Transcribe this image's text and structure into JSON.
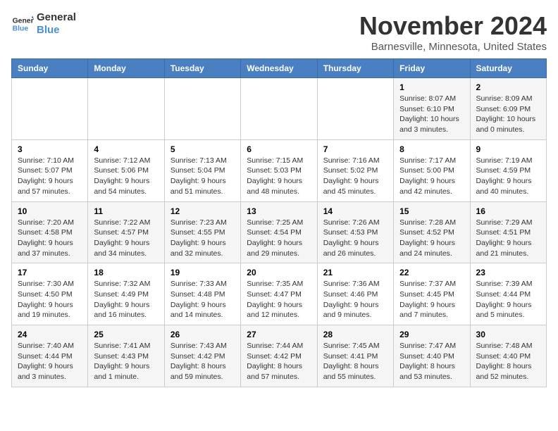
{
  "logo": {
    "text_general": "General",
    "text_blue": "Blue"
  },
  "header": {
    "title": "November 2024",
    "subtitle": "Barnesville, Minnesota, United States"
  },
  "weekdays": [
    "Sunday",
    "Monday",
    "Tuesday",
    "Wednesday",
    "Thursday",
    "Friday",
    "Saturday"
  ],
  "weeks": [
    [
      {
        "day": "",
        "info": ""
      },
      {
        "day": "",
        "info": ""
      },
      {
        "day": "",
        "info": ""
      },
      {
        "day": "",
        "info": ""
      },
      {
        "day": "",
        "info": ""
      },
      {
        "day": "1",
        "info": "Sunrise: 8:07 AM\nSunset: 6:10 PM\nDaylight: 10 hours and 3 minutes."
      },
      {
        "day": "2",
        "info": "Sunrise: 8:09 AM\nSunset: 6:09 PM\nDaylight: 10 hours and 0 minutes."
      }
    ],
    [
      {
        "day": "3",
        "info": "Sunrise: 7:10 AM\nSunset: 5:07 PM\nDaylight: 9 hours and 57 minutes."
      },
      {
        "day": "4",
        "info": "Sunrise: 7:12 AM\nSunset: 5:06 PM\nDaylight: 9 hours and 54 minutes."
      },
      {
        "day": "5",
        "info": "Sunrise: 7:13 AM\nSunset: 5:04 PM\nDaylight: 9 hours and 51 minutes."
      },
      {
        "day": "6",
        "info": "Sunrise: 7:15 AM\nSunset: 5:03 PM\nDaylight: 9 hours and 48 minutes."
      },
      {
        "day": "7",
        "info": "Sunrise: 7:16 AM\nSunset: 5:02 PM\nDaylight: 9 hours and 45 minutes."
      },
      {
        "day": "8",
        "info": "Sunrise: 7:17 AM\nSunset: 5:00 PM\nDaylight: 9 hours and 42 minutes."
      },
      {
        "day": "9",
        "info": "Sunrise: 7:19 AM\nSunset: 4:59 PM\nDaylight: 9 hours and 40 minutes."
      }
    ],
    [
      {
        "day": "10",
        "info": "Sunrise: 7:20 AM\nSunset: 4:58 PM\nDaylight: 9 hours and 37 minutes."
      },
      {
        "day": "11",
        "info": "Sunrise: 7:22 AM\nSunset: 4:57 PM\nDaylight: 9 hours and 34 minutes."
      },
      {
        "day": "12",
        "info": "Sunrise: 7:23 AM\nSunset: 4:55 PM\nDaylight: 9 hours and 32 minutes."
      },
      {
        "day": "13",
        "info": "Sunrise: 7:25 AM\nSunset: 4:54 PM\nDaylight: 9 hours and 29 minutes."
      },
      {
        "day": "14",
        "info": "Sunrise: 7:26 AM\nSunset: 4:53 PM\nDaylight: 9 hours and 26 minutes."
      },
      {
        "day": "15",
        "info": "Sunrise: 7:28 AM\nSunset: 4:52 PM\nDaylight: 9 hours and 24 minutes."
      },
      {
        "day": "16",
        "info": "Sunrise: 7:29 AM\nSunset: 4:51 PM\nDaylight: 9 hours and 21 minutes."
      }
    ],
    [
      {
        "day": "17",
        "info": "Sunrise: 7:30 AM\nSunset: 4:50 PM\nDaylight: 9 hours and 19 minutes."
      },
      {
        "day": "18",
        "info": "Sunrise: 7:32 AM\nSunset: 4:49 PM\nDaylight: 9 hours and 16 minutes."
      },
      {
        "day": "19",
        "info": "Sunrise: 7:33 AM\nSunset: 4:48 PM\nDaylight: 9 hours and 14 minutes."
      },
      {
        "day": "20",
        "info": "Sunrise: 7:35 AM\nSunset: 4:47 PM\nDaylight: 9 hours and 12 minutes."
      },
      {
        "day": "21",
        "info": "Sunrise: 7:36 AM\nSunset: 4:46 PM\nDaylight: 9 hours and 9 minutes."
      },
      {
        "day": "22",
        "info": "Sunrise: 7:37 AM\nSunset: 4:45 PM\nDaylight: 9 hours and 7 minutes."
      },
      {
        "day": "23",
        "info": "Sunrise: 7:39 AM\nSunset: 4:44 PM\nDaylight: 9 hours and 5 minutes."
      }
    ],
    [
      {
        "day": "24",
        "info": "Sunrise: 7:40 AM\nSunset: 4:44 PM\nDaylight: 9 hours and 3 minutes."
      },
      {
        "day": "25",
        "info": "Sunrise: 7:41 AM\nSunset: 4:43 PM\nDaylight: 9 hours and 1 minute."
      },
      {
        "day": "26",
        "info": "Sunrise: 7:43 AM\nSunset: 4:42 PM\nDaylight: 8 hours and 59 minutes."
      },
      {
        "day": "27",
        "info": "Sunrise: 7:44 AM\nSunset: 4:42 PM\nDaylight: 8 hours and 57 minutes."
      },
      {
        "day": "28",
        "info": "Sunrise: 7:45 AM\nSunset: 4:41 PM\nDaylight: 8 hours and 55 minutes."
      },
      {
        "day": "29",
        "info": "Sunrise: 7:47 AM\nSunset: 4:40 PM\nDaylight: 8 hours and 53 minutes."
      },
      {
        "day": "30",
        "info": "Sunrise: 7:48 AM\nSunset: 4:40 PM\nDaylight: 8 hours and 52 minutes."
      }
    ]
  ]
}
